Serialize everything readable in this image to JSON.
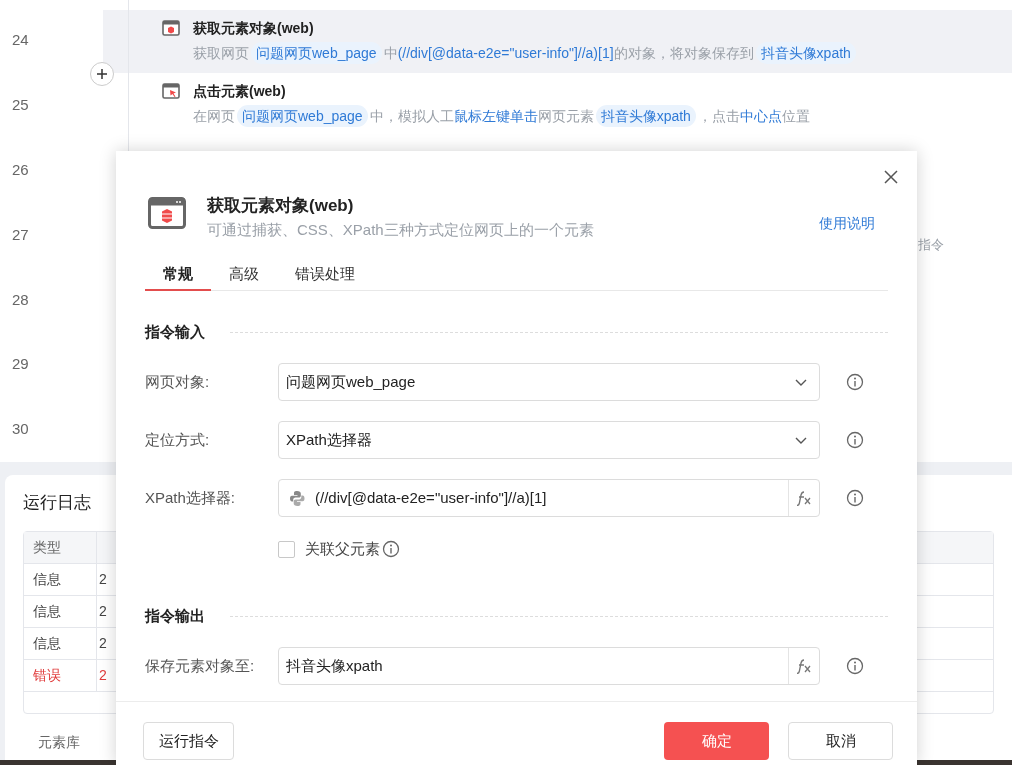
{
  "editor": {
    "line_numbers": [
      "24",
      "25",
      "26",
      "27",
      "28",
      "29",
      "30"
    ],
    "steps": [
      {
        "title": "获取元素对象(web)",
        "kind": "element",
        "selected": true,
        "description": [
          {
            "kind": "text",
            "text": "获取网页"
          },
          {
            "kind": "chip",
            "text": "问题网页web_page"
          },
          {
            "kind": "text",
            "text": "中"
          },
          {
            "kind": "value",
            "text": "(//div[@data-e2e=\"user-info\"]//a)[1]"
          },
          {
            "kind": "text",
            "text": "的对象，将对象保存到"
          },
          {
            "kind": "chip",
            "text": "抖音头像xpath"
          }
        ]
      },
      {
        "title": "点击元素(web)",
        "kind": "click",
        "selected": false,
        "description": [
          {
            "kind": "text",
            "text": "在网页"
          },
          {
            "kind": "chip",
            "text": "问题网页web_page"
          },
          {
            "kind": "text",
            "text": "中，模拟人工"
          },
          {
            "kind": "value",
            "text": "鼠标左键单击"
          },
          {
            "kind": "text",
            "text": "网页元素"
          },
          {
            "kind": "chip",
            "text": "抖音头像xpath"
          },
          {
            "kind": "text",
            "text": "，点击"
          },
          {
            "kind": "value",
            "text": "中心点"
          },
          {
            "kind": "text",
            "text": "位置"
          }
        ]
      }
    ],
    "hidden_step_text": "指令"
  },
  "log_panel": {
    "title": "运行日志",
    "columns": [
      "类型"
    ],
    "rows": [
      {
        "kind": "info",
        "type": "信息",
        "column_2": "2"
      },
      {
        "kind": "info",
        "type": "信息",
        "column_2": "2"
      },
      {
        "kind": "info",
        "type": "信息",
        "column_2": "2"
      },
      {
        "kind": "error",
        "type": "错误",
        "column_2": "2"
      }
    ],
    "bottom_tab": "元素库"
  },
  "dialog": {
    "title": "获取元素对象(web)",
    "subtitle": "可通过捕获、CSS、XPath三种方式定位网页上的一个元素",
    "help_link": "使用说明",
    "tabs": [
      {
        "label": "常规",
        "selected": true
      },
      {
        "label": "高级",
        "selected": false
      },
      {
        "label": "错误处理",
        "selected": false
      }
    ],
    "sections": [
      {
        "title": "指令输入",
        "fields": [
          {
            "kind": "select",
            "label": "网页对象:",
            "value": "问题网页web_page"
          },
          {
            "kind": "select",
            "label": "定位方式:",
            "value": "XPath选择器"
          },
          {
            "kind": "code",
            "label": "XPath选择器:",
            "value": "(//div[@data-e2e=\"user-info\"]//a)[1]"
          },
          {
            "kind": "checkbox",
            "label": "关联父元素",
            "checked": false
          }
        ]
      },
      {
        "title": "指令输出",
        "fields": [
          {
            "kind": "variable",
            "label": "保存元素对象至:",
            "value": "抖音头像xpath"
          }
        ]
      }
    ],
    "buttons": {
      "run": "运行指令",
      "ok": "确定",
      "cancel": "取消"
    }
  }
}
